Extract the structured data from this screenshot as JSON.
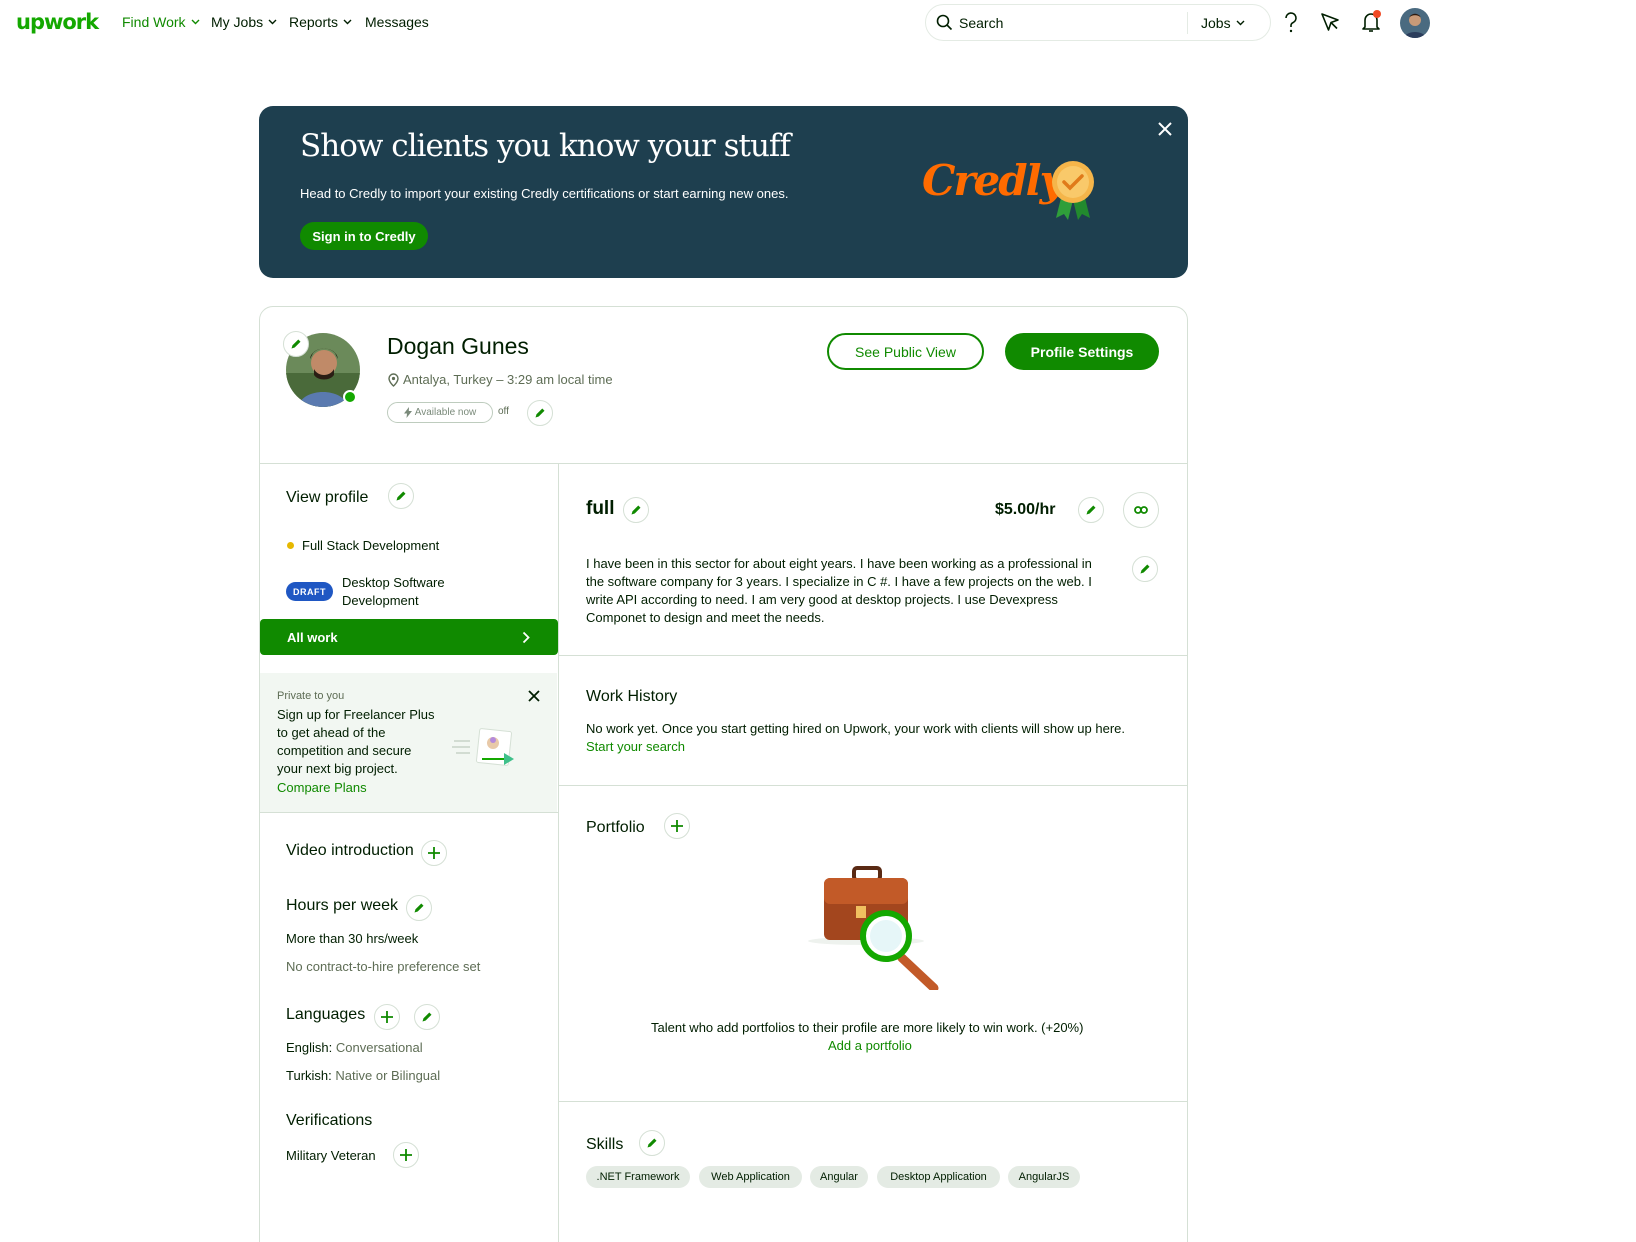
{
  "nav": {
    "logo": "upwork",
    "find_work": "Find Work",
    "my_jobs": "My Jobs",
    "reports": "Reports",
    "messages": "Messages",
    "search_placeholder": "Search",
    "search_scope": "Jobs",
    "help_icon": "help-icon",
    "send_icon": "direct-contracts-icon",
    "bell_icon": "notifications-bell-icon",
    "notification_dot_color": "#f04a25"
  },
  "banner": {
    "title": "Show clients you know your stuff",
    "subtitle": "Head to Credly to import your existing Credly certifications or start earning new ones.",
    "button": "Sign in to Credly",
    "brand": "Credly",
    "bg_color": "#1e3f4f"
  },
  "profile": {
    "name": "Dogan Gunes",
    "location": "Antalya, Turkey – 3:29 am local time",
    "availability_label": "Available now",
    "availability_state": "off",
    "see_public_view": "See Public View",
    "profile_settings": "Profile Settings"
  },
  "sidebar": {
    "view_profile": "View profile",
    "specialized_1": "Full Stack Development",
    "draft_badge": "DRAFT",
    "specialized_2_line1": "Desktop Software",
    "specialized_2_line2": "Development",
    "all_work": "All work",
    "promo": {
      "eyebrow": "Private to you",
      "line1": "Sign up for Freelancer Plus",
      "line2": "to get ahead of the",
      "line3": "competition and secure",
      "line4": "your next big project.",
      "link": "Compare Plans"
    },
    "video_intro": "Video introduction",
    "hours_title": "Hours per week",
    "hours_value": "More than 30 hrs/week",
    "hours_pref": "No contract-to-hire preference set",
    "languages_title": "Languages",
    "languages": [
      {
        "name": "English:",
        "level": "Conversational"
      },
      {
        "name": "Turkish:",
        "level": "Native or Bilingual"
      }
    ],
    "verifications_title": "Verifications",
    "military": "Military Veteran"
  },
  "main": {
    "headline": "full",
    "rate": "$5.00/hr",
    "overview": [
      "I have been in this sector for about eight years. I have been working as a professional in",
      "the software company for 3 years. I specialize in C #. I have a few projects on the web. I",
      "write API according to need. I am very good at desktop projects. I use Devexpress",
      "Componet to design and meet the needs."
    ],
    "work_history_title": "Work History",
    "work_history_text": "No work yet. Once you start getting hired on Upwork, your work with clients will show up here.",
    "work_history_link": "Start your search",
    "portfolio_title": "Portfolio",
    "portfolio_text": "Talent who add portfolios to their profile are more likely to win work. (+20%)",
    "portfolio_link": "Add a portfolio",
    "skills_title": "Skills",
    "skills": [
      ".NET Framework",
      "Web Application",
      "Angular",
      "Desktop Application",
      "AngularJS"
    ]
  },
  "colors": {
    "brand_green": "#108a00",
    "logo_green": "#14a800",
    "border": "#d5e0d5",
    "draft_blue": "#1f57c3"
  }
}
